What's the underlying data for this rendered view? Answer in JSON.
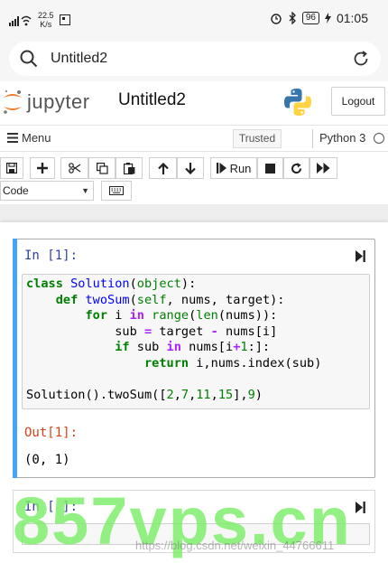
{
  "status_bar": {
    "net_speed_value": "22.5",
    "net_speed_unit": "K/s",
    "battery": "96",
    "time": "01:05"
  },
  "address_bar": {
    "text": "Untitled2"
  },
  "header": {
    "logo_text": "jupyter",
    "notebook_title": "Untitled2",
    "logout_label": "Logout"
  },
  "menubar": {
    "menu_label": "Menu",
    "trusted_label": "Trusted",
    "kernel_name": "Python 3"
  },
  "toolbar": {
    "run_label": "Run",
    "cell_type": "Code"
  },
  "cells": [
    {
      "in_prompt": "In [1]:",
      "out_prompt": "Out[1]:",
      "output": "(0, 1)"
    },
    {
      "in_prompt": "In [ ]:"
    }
  ],
  "watermarks": {
    "brand": "857vps.cn",
    "url": "https://blog.csdn.net/weixin_44766611"
  },
  "colors": {
    "accent_blue": "#42a5f5",
    "in_prompt": "#303f9f",
    "out_prompt": "#d84315",
    "watermark_green": "#78ee64"
  }
}
